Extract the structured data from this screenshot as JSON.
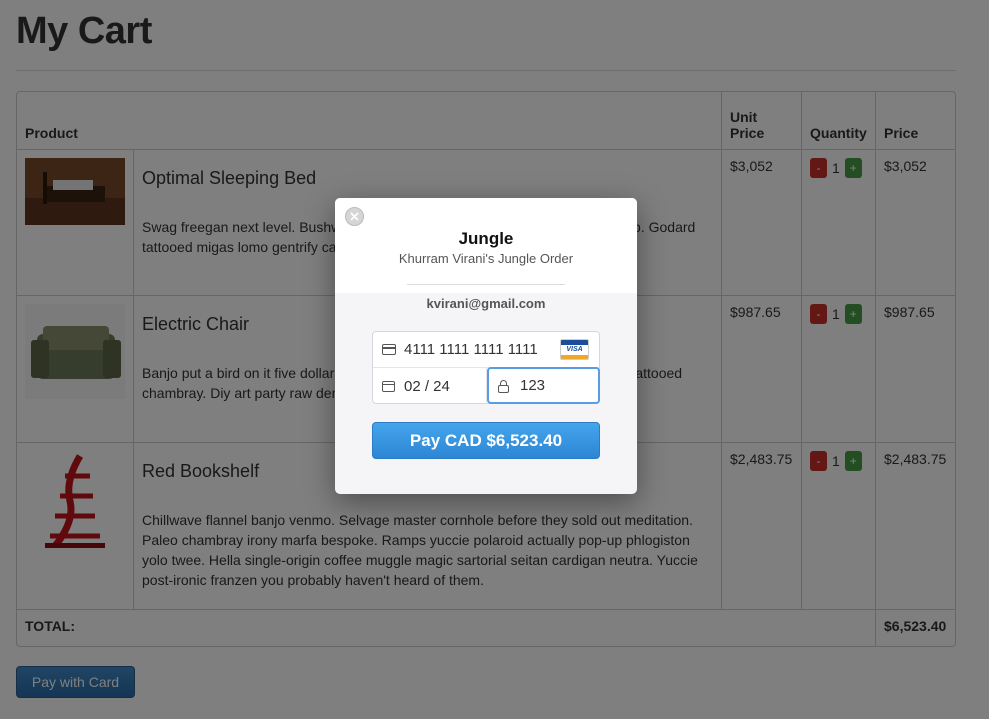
{
  "page": {
    "title": "My Cart"
  },
  "table": {
    "headers": {
      "product": "Product",
      "unit_price": "Unit Price",
      "quantity": "Quantity",
      "price": "Price"
    },
    "rows": [
      {
        "name": "Optimal Sleeping Bed",
        "desc": "Swag freegan next level. Bushwick hoodie ethical chambray 3 wolf moon pop-up. Godard tattooed migas lomo gentrify cardigan sartorial.",
        "unit_price": "$3,052",
        "qty": "1",
        "price": "$3,052",
        "minus": "-",
        "plus": "+"
      },
      {
        "name": "Electric Chair",
        "desc": "Banjo put a bird on it five dollar toast cray express roof. Selfies five dollar toast tattooed chambray. Diy art party raw denim.",
        "unit_price": "$987.65",
        "qty": "1",
        "price": "$987.65",
        "minus": "-",
        "plus": "+"
      },
      {
        "name": "Red Bookshelf",
        "desc": "Chillwave flannel banjo venmo. Selvage master cornhole before they sold out meditation. Paleo chambray irony marfa bespoke. Ramps yuccie polaroid actually pop-up phlogiston yolo twee. Hella single-origin coffee muggle magic sartorial seitan cardigan neutra. Yuccie post-ironic franzen you probably haven't heard of them.",
        "unit_price": "$2,483.75",
        "qty": "1",
        "price": "$2,483.75",
        "minus": "-",
        "plus": "+"
      }
    ],
    "total_label": "TOTAL:",
    "total_value": "$6,523.40"
  },
  "pay_with_card": "Pay with Card",
  "modal": {
    "name": "Jungle",
    "description": "Khurram Virani's Jungle Order",
    "email": "kvirani@gmail.com",
    "card_number": "4111 1111 1111 1111",
    "card_brand": "VISA",
    "expiry": "02 / 24",
    "cvc": "123",
    "pay_button": "Pay CAD $6,523.40"
  },
  "colors": {
    "pay_button": "#3a97e0",
    "minus": "#c9302c",
    "plus": "#449d44",
    "primary": "#3276b1"
  }
}
